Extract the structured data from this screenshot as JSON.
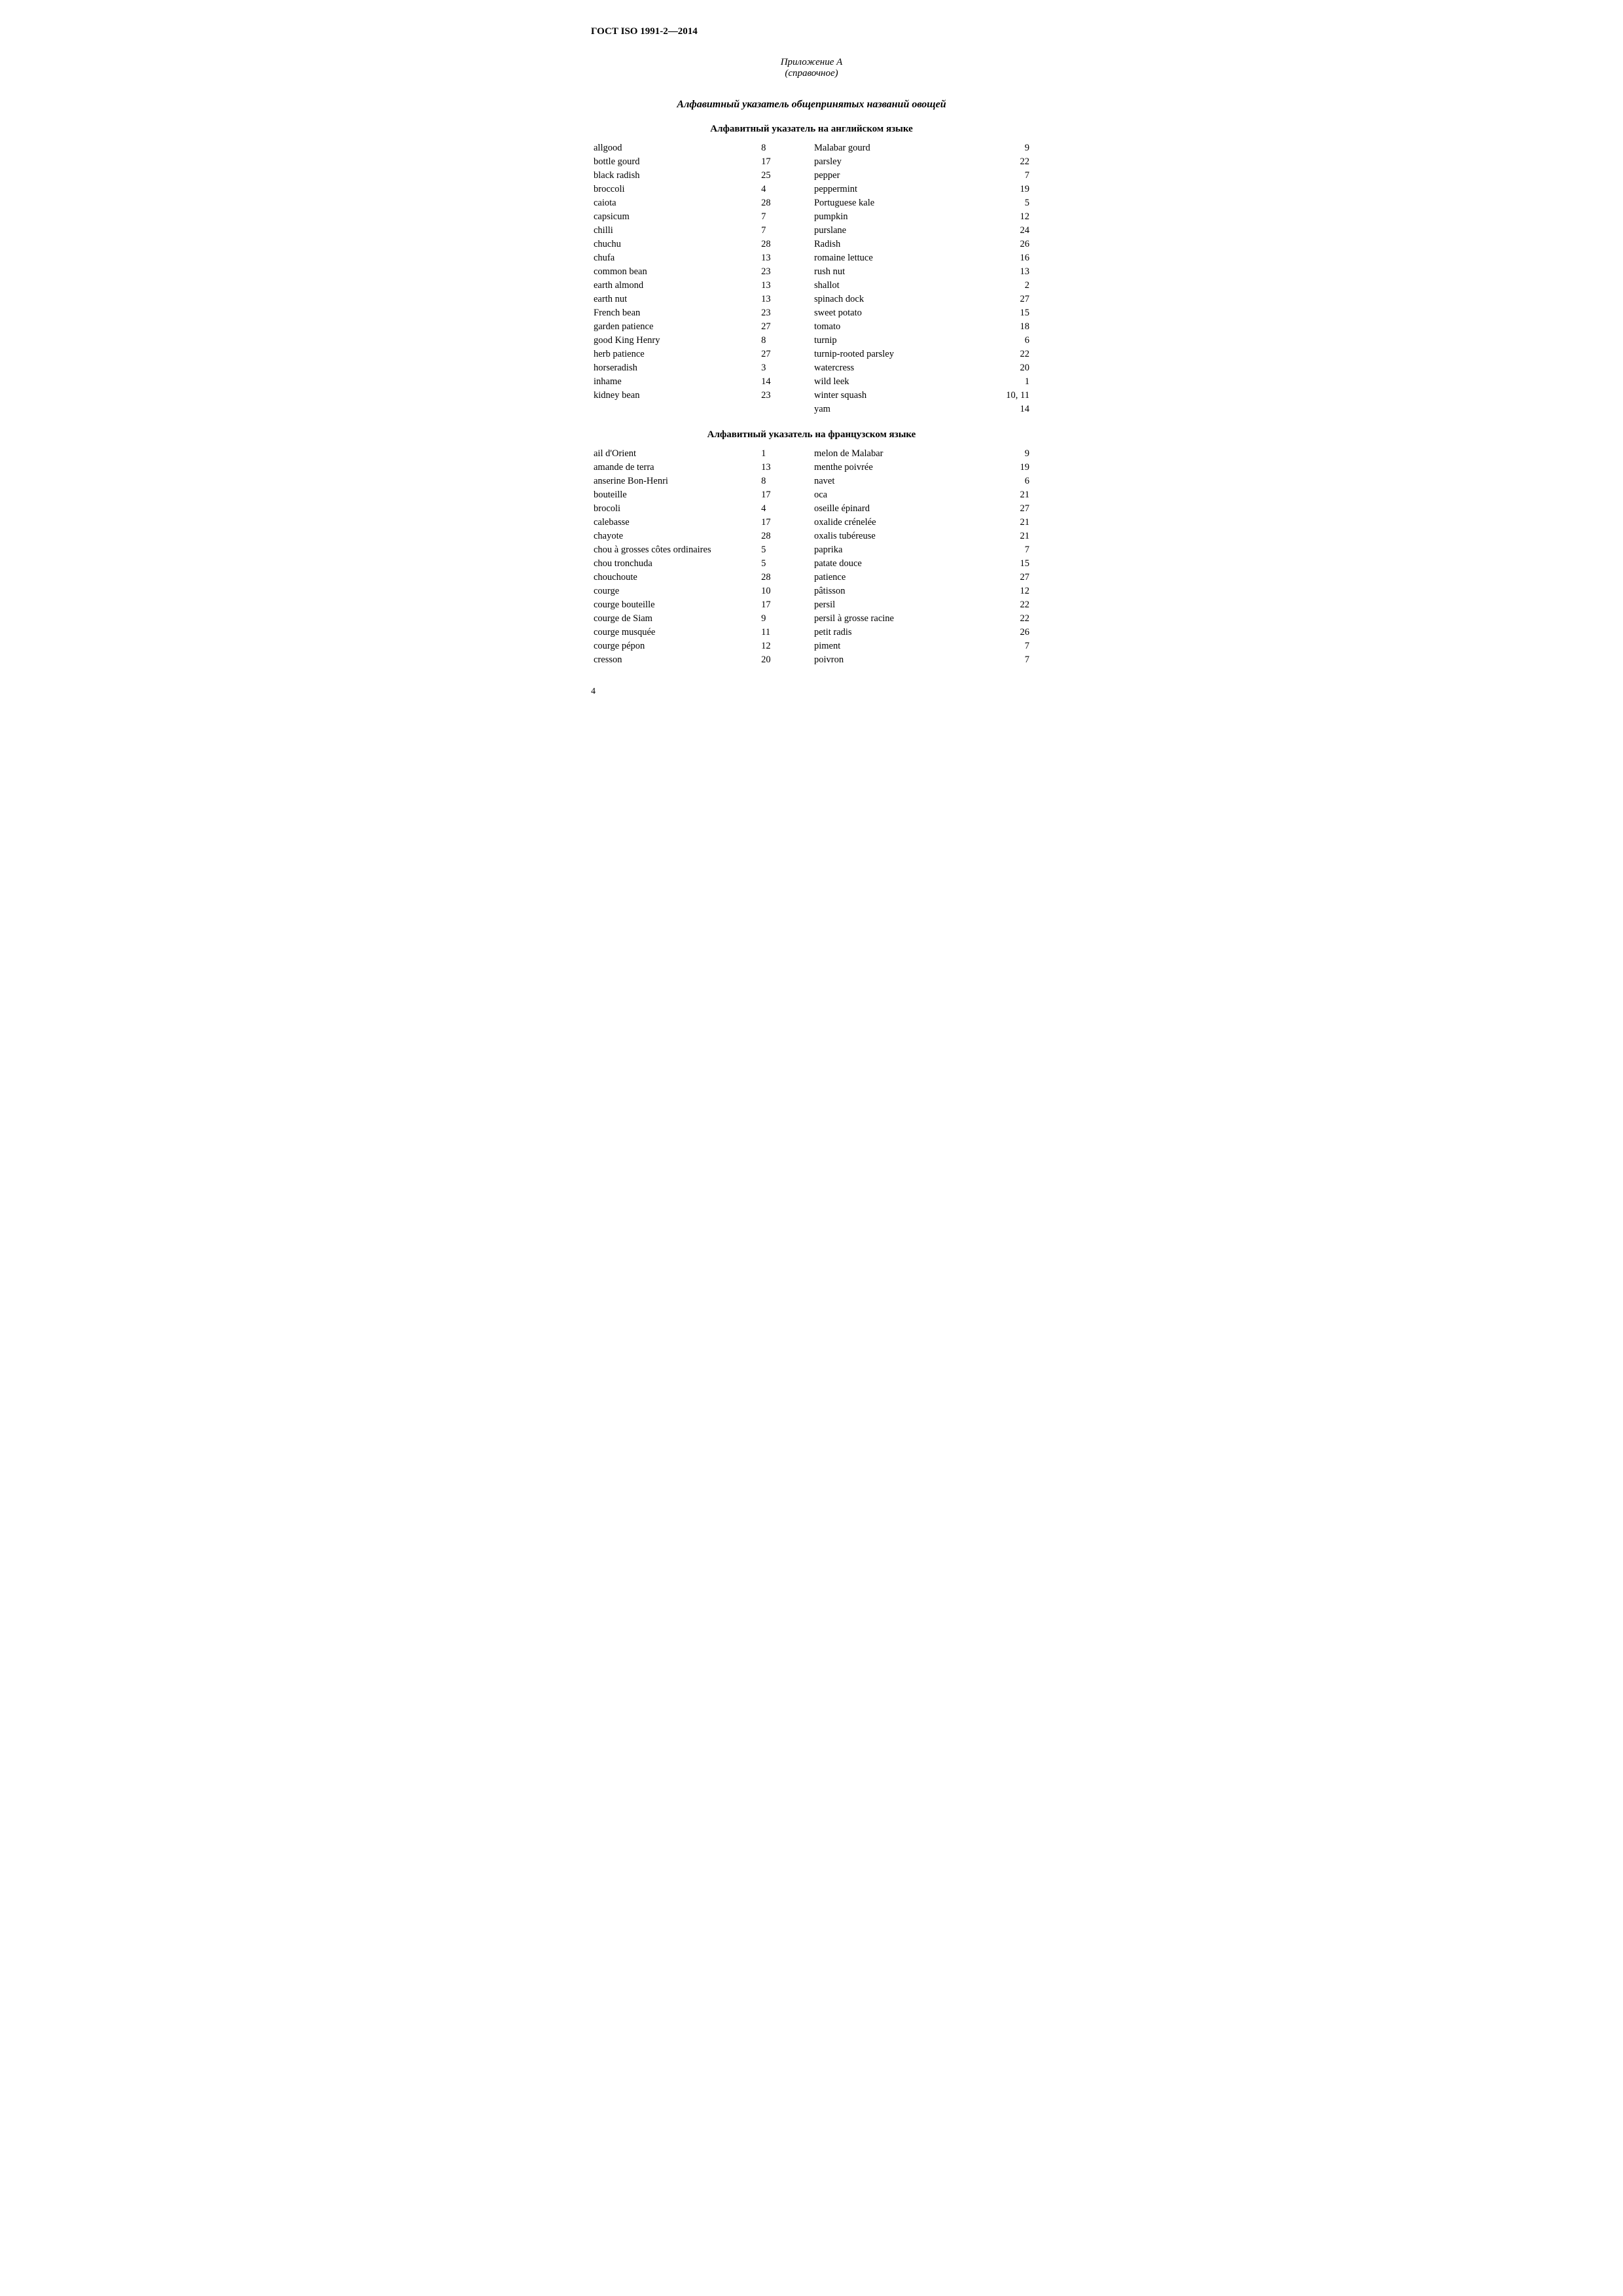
{
  "header": {
    "gost": "ГОСТ ISO 1991-2—2014"
  },
  "appendix": {
    "line1": "Приложение А",
    "line2": "(справочное)"
  },
  "mainTitle": "Алфавитный указатель общепринятых названий овощей",
  "englishSection": {
    "title": "Алфавитный указатель на английском языке",
    "leftItems": [
      {
        "term": "allgood",
        "num": "8"
      },
      {
        "term": "bottle gourd",
        "num": "17"
      },
      {
        "term": "black radish",
        "num": "25"
      },
      {
        "term": "broccoli",
        "num": "4"
      },
      {
        "term": "caiota",
        "num": "28"
      },
      {
        "term": "capsicum",
        "num": "7"
      },
      {
        "term": "chilli",
        "num": "7"
      },
      {
        "term": "chuchu",
        "num": "28"
      },
      {
        "term": "chufa",
        "num": "13"
      },
      {
        "term": "common bean",
        "num": "23"
      },
      {
        "term": "earth almond",
        "num": "13"
      },
      {
        "term": "earth nut",
        "num": "13"
      },
      {
        "term": "French bean",
        "num": "23"
      },
      {
        "term": "garden patience",
        "num": "27"
      },
      {
        "term": "good King Henry",
        "num": "8"
      },
      {
        "term": "herb patience",
        "num": "27"
      },
      {
        "term": "horseradish",
        "num": "3"
      },
      {
        "term": "inhame",
        "num": "14"
      },
      {
        "term": "kidney bean",
        "num": "23"
      }
    ],
    "rightItems": [
      {
        "term": "Malabar gourd",
        "num": "9"
      },
      {
        "term": "parsley",
        "num": "22"
      },
      {
        "term": "pepper",
        "num": "7"
      },
      {
        "term": "peppermint",
        "num": "19"
      },
      {
        "term": "Portuguese kale",
        "num": "5"
      },
      {
        "term": "pumpkin",
        "num": "12"
      },
      {
        "term": "purslane",
        "num": "24"
      },
      {
        "term": "Radish",
        "num": "26"
      },
      {
        "term": "romaine lettuce",
        "num": "16"
      },
      {
        "term": "rush nut",
        "num": "13"
      },
      {
        "term": "shallot",
        "num": "2"
      },
      {
        "term": "spinach dock",
        "num": "27"
      },
      {
        "term": "sweet potato",
        "num": "15"
      },
      {
        "term": "tomato",
        "num": "18"
      },
      {
        "term": "turnip",
        "num": "6"
      },
      {
        "term": "turnip-rooted parsley",
        "num": "22"
      },
      {
        "term": "watercress",
        "num": "20"
      },
      {
        "term": "wild leek",
        "num": "1"
      },
      {
        "term": "winter squash",
        "num": "10, 11"
      },
      {
        "term": "yam",
        "num": "14"
      }
    ]
  },
  "frenchSection": {
    "title": "Алфавитный указатель на французском языке",
    "leftItems": [
      {
        "term": "ail d'Orient",
        "num": "1"
      },
      {
        "term": "amande de terra",
        "num": "13"
      },
      {
        "term": "anserine Bon-Henri",
        "num": "8"
      },
      {
        "term": "bouteille",
        "num": "17"
      },
      {
        "term": "brocoli",
        "num": "4"
      },
      {
        "term": "calebasse",
        "num": "17"
      },
      {
        "term": "chayote",
        "num": "28"
      },
      {
        "term": "chou à grosses côtes ordinaires",
        "num": "5"
      },
      {
        "term": "chou tronchuda",
        "num": "5"
      },
      {
        "term": "chouchoute",
        "num": "28"
      },
      {
        "term": "courge",
        "num": "10"
      },
      {
        "term": "courge bouteille",
        "num": "17"
      },
      {
        "term": "courge de Siam",
        "num": "9"
      },
      {
        "term": "courge musquée",
        "num": "11"
      },
      {
        "term": "courge pépon",
        "num": "12"
      },
      {
        "term": "cresson",
        "num": "20"
      }
    ],
    "rightItems": [
      {
        "term": "melon de Malabar",
        "num": "9"
      },
      {
        "term": "menthe poivrée",
        "num": "19"
      },
      {
        "term": "navet",
        "num": "6"
      },
      {
        "term": "oca",
        "num": "21"
      },
      {
        "term": "oseille épinard",
        "num": "27"
      },
      {
        "term": "oxalide crénelée",
        "num": "21"
      },
      {
        "term": "oxalis tubéreuse",
        "num": "21"
      },
      {
        "term": "paprika",
        "num": "7"
      },
      {
        "term": "patate douce",
        "num": "15"
      },
      {
        "term": "patience",
        "num": "27"
      },
      {
        "term": "pâtisson",
        "num": "12"
      },
      {
        "term": "persil",
        "num": "22"
      },
      {
        "term": "persil à grosse racine",
        "num": "22"
      },
      {
        "term": "petit radis",
        "num": "26"
      },
      {
        "term": "piment",
        "num": "7"
      },
      {
        "term": "poivron",
        "num": "7"
      }
    ]
  },
  "pageNum": "4"
}
